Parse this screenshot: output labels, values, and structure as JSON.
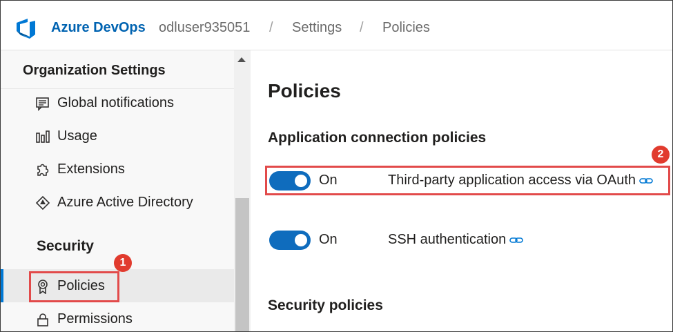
{
  "header": {
    "brand": "Azure DevOps",
    "breadcrumbs": [
      "odluser935051",
      "Settings",
      "Policies"
    ],
    "separator": "/",
    "brand_color": "#0063b1"
  },
  "sidebar": {
    "title": "Organization Settings",
    "items": [
      {
        "label": "Global notifications",
        "icon": "notification-icon"
      },
      {
        "label": "Usage",
        "icon": "usage-chart-icon"
      },
      {
        "label": "Extensions",
        "icon": "puzzle-icon"
      },
      {
        "label": "Azure Active Directory",
        "icon": "azure-ad-icon"
      }
    ],
    "section": "Security",
    "security_items": [
      {
        "label": "Policies",
        "icon": "badge-icon",
        "active": true
      },
      {
        "label": "Permissions",
        "icon": "lock-icon"
      }
    ]
  },
  "main": {
    "title": "Policies",
    "app_section": "Application connection policies",
    "policies": [
      {
        "state": "On",
        "label": "Third-party application access via OAuth",
        "enabled": true
      },
      {
        "state": "On",
        "label": "SSH authentication",
        "enabled": true
      }
    ],
    "security_section": "Security policies"
  },
  "annotations": [
    {
      "number": "1"
    },
    {
      "number": "2"
    }
  ],
  "colors": {
    "toggle_on": "#0f6cbd",
    "highlight": "#e24a4a",
    "accent": "#0078d4"
  }
}
